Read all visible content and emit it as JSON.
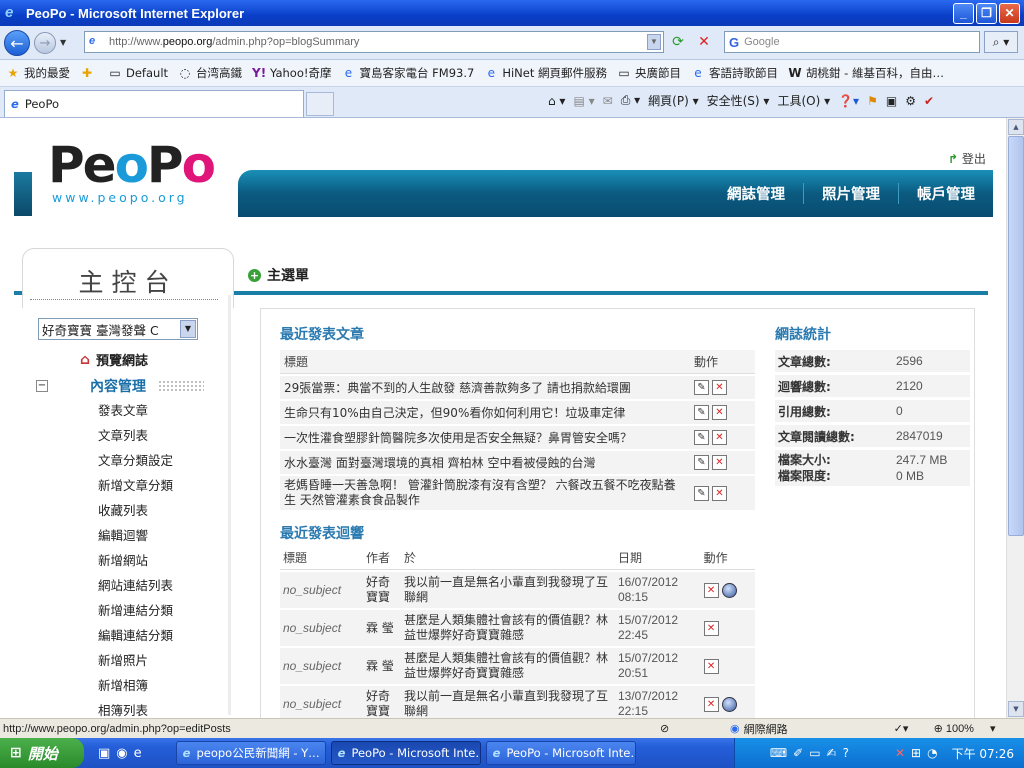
{
  "window": {
    "title": "PeoPo - Microsoft Internet Explorer"
  },
  "address": {
    "prefix": "http://www.",
    "host": "peopo.org",
    "path": "/admin.php?op=blogSummary"
  },
  "search": {
    "placeholder": "Google",
    "engine_logo": "G"
  },
  "favorites": {
    "label": "我的最愛",
    "items": [
      "Default",
      "台湾高鐵",
      "Yahoo!奇摩",
      "寶島客家電台 FM93.7",
      "HiNet 網頁郵件服務",
      "央廣節目",
      "客語詩歌節目",
      "胡桃鉗 - 維基百科，自由…"
    ]
  },
  "tab": {
    "label": "PeoPo"
  },
  "toolbar": {
    "page": "網頁(P)",
    "safety": "安全性(S)",
    "tools": "工具(O)"
  },
  "site": {
    "logo": {
      "k1": "Pe",
      "b": "o",
      "k2": "P",
      "m": "o"
    },
    "logo_sub": "www.peopo.org",
    "logout": "登出",
    "nav": [
      "網誌管理",
      "照片管理",
      "帳戶管理"
    ],
    "console_title": "主控台",
    "main_menu": "主選單",
    "blog_select": "好奇寶寶 臺灣發聲 C",
    "preview": "預覽網誌",
    "content_mgmt": "內容管理",
    "sidebar": [
      "發表文章",
      "文章列表",
      "文章分類設定",
      "新增文章分類",
      "收藏列表",
      "編輯迴響",
      "新增網站",
      "網站連結列表",
      "新增連結分類",
      "編輯連結分類",
      "新增照片",
      "新增相簿",
      "相簿列表"
    ]
  },
  "recent_posts": {
    "title": "最近發表文章",
    "headers": {
      "title": "標題",
      "action": "動作"
    },
    "rows": [
      "29張當票：典當不到的人生啟發 慈濟善款夠多了 請也捐款給環團",
      "生命只有10%由自己決定，但90%看你如何利用它！垃圾車定律",
      "一次性灌食塑膠針筒醫院多次使用是否安全無疑？鼻胃管安全嗎？",
      "水水臺灣 面對臺灣環境的真相 齊柏林 空中看被侵蝕的台灣",
      "老媽昏睡一天善急啊！ 管灌針筒脫漆有沒有含塑？ 六餐改五餐不吃夜點養生 天然管灌素食食品製作"
    ]
  },
  "recent_comments": {
    "title": "最近發表迴響",
    "headers": {
      "title": "標題",
      "author": "作者",
      "content": "於",
      "date": "日期",
      "action": "動作"
    },
    "rows": [
      {
        "subject": "no_subject",
        "author": "好奇寶寶",
        "content": "我以前一直是無名小輩直到我發現了互聯網",
        "date": "16/07/2012",
        "time": "08:15"
      },
      {
        "subject": "no_subject",
        "author": "霖 瑩",
        "content": "甚麼是人類集體社會該有的價值觀？林益世爆弊好奇寶寶雜感",
        "date": "15/07/2012",
        "time": "22:45"
      },
      {
        "subject": "no_subject",
        "author": "霖 瑩",
        "content": "甚麼是人類集體社會該有的價值觀？林益世爆弊好奇寶寶雜感",
        "date": "15/07/2012",
        "time": "20:51"
      },
      {
        "subject": "no_subject",
        "author": "好奇寶寶",
        "content": "我以前一直是無名小輩直到我發現了互聯網",
        "date": "13/07/2012",
        "time": "22:15"
      }
    ]
  },
  "stats": {
    "title": "網誌統計",
    "rows": [
      {
        "k": "文章總數:",
        "v": "2596"
      },
      {
        "k": "迴響總數:",
        "v": "2120"
      },
      {
        "k": "引用總數:",
        "v": "0"
      },
      {
        "k": "文章閱讀總數:",
        "v": "2847019"
      },
      {
        "k": "檔案大小:",
        "v": "247.7 MB"
      },
      {
        "k": "檔案限度:",
        "v": "0 MB"
      }
    ]
  },
  "statusbar": {
    "url": "http://www.peopo.org/admin.php?op=editPosts",
    "zone": "網際網路",
    "zoom": "100%"
  },
  "taskbar": {
    "start": "開始",
    "buttons": [
      "peopo公民新聞網 - Y…",
      "PeoPo - Microsoft Inte…",
      "PeoPo - Microsoft Inte…"
    ],
    "clock": "下午 07:26"
  }
}
